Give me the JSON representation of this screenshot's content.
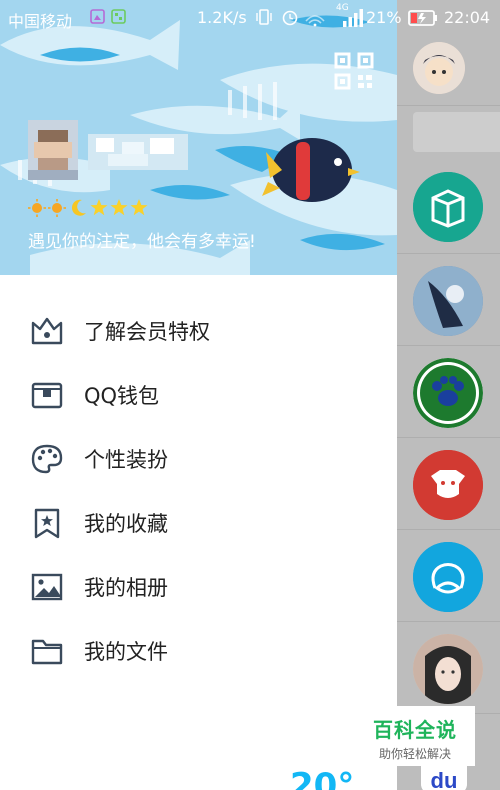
{
  "status_bar": {
    "carrier": "中国移动",
    "speed": "1.2K/s",
    "network": "4G",
    "battery": "21%",
    "time": "22:04"
  },
  "profile": {
    "level_icons": [
      "sun-icon",
      "sun-icon",
      "moon-icon",
      "star-icon",
      "star-icon",
      "star-icon"
    ],
    "signature": "遇见你的注定，他会有多幸运!"
  },
  "menu": {
    "items": [
      {
        "label": "了解会员特权",
        "icon": "crown-icon"
      },
      {
        "label": "QQ钱包",
        "icon": "wallet-icon"
      },
      {
        "label": "个性装扮",
        "icon": "palette-icon"
      },
      {
        "label": "我的收藏",
        "icon": "bookmark-icon"
      },
      {
        "label": "我的相册",
        "icon": "photo-icon"
      },
      {
        "label": "我的文件",
        "icon": "folder-icon"
      }
    ]
  },
  "bottom": {
    "partial_text": "20°"
  },
  "watermark": {
    "title": "百科全说",
    "subtitle": "助你轻松解决"
  },
  "colors": {
    "banner": "#9fd3ee",
    "qq_blue": "#12b7f5",
    "dim": "#bdbdbd",
    "watermark_green": "#1fb45b"
  }
}
